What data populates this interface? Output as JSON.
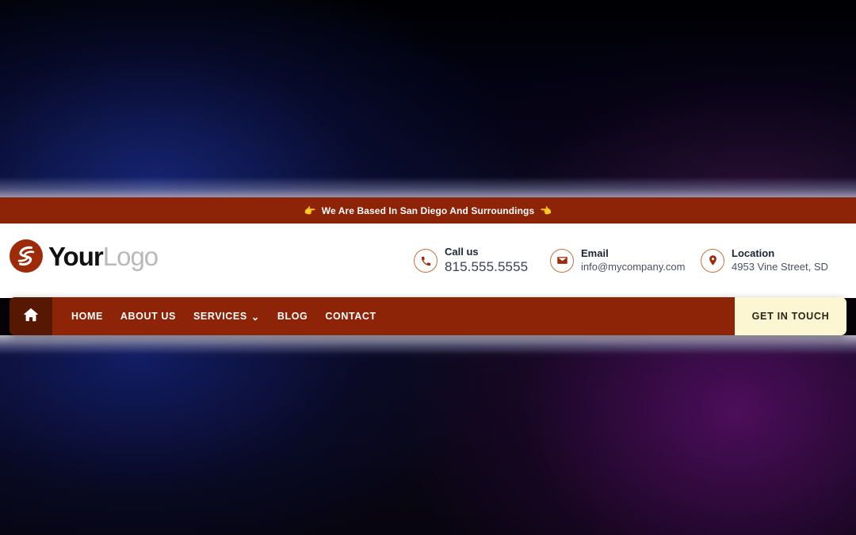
{
  "announcement": {
    "left_emoji": "👉",
    "text": "We Are Based In San Diego And Surroundings",
    "right_emoji": "👈",
    "background": "#8d2307",
    "text_color": "#ffffff"
  },
  "logo": {
    "mark_icon": "swoosh-logo-mark",
    "mark_color": "#9d2b0a",
    "primary_text": "Your",
    "secondary_text": "Logo",
    "primary_color": "#111111",
    "secondary_color": "#b9b9b9"
  },
  "contacts": [
    {
      "icon": "phone-icon",
      "label": "Call us",
      "value": "815.555.5555"
    },
    {
      "icon": "envelope-icon",
      "label": "Email",
      "value": "info@mycompany.com"
    },
    {
      "icon": "map-pin-icon",
      "label": "Location",
      "value": "4953 Vine Street, SD"
    }
  ],
  "nav": {
    "home_icon": "house-icon",
    "background": "#8d2307",
    "home_block_background": "#561703",
    "links": [
      {
        "label": "HOME",
        "has_dropdown": false
      },
      {
        "label": "ABOUT US",
        "has_dropdown": false
      },
      {
        "label": "SERVICES",
        "has_dropdown": true,
        "chevron": "⌄"
      },
      {
        "label": "BLOG",
        "has_dropdown": false
      },
      {
        "label": "CONTACT",
        "has_dropdown": false
      }
    ],
    "cta": {
      "label": "GET IN TOUCH",
      "background": "#fdf6d2",
      "text_color": "#2a2416"
    }
  },
  "theme": {
    "accent": "#8d2307",
    "accent_dark": "#561703",
    "cream": "#fdf6d2",
    "icon_ring": "#c3723f"
  }
}
